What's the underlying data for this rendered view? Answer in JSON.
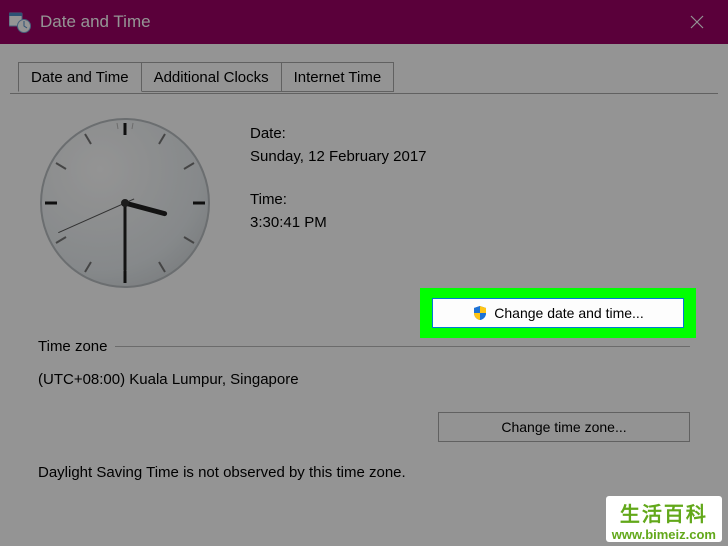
{
  "window": {
    "title": "Date and Time"
  },
  "tabs": {
    "date_and_time": "Date and Time",
    "additional_clocks": "Additional Clocks",
    "internet_time": "Internet Time"
  },
  "labels": {
    "date": "Date:",
    "time": "Time:",
    "time_zone": "Time zone"
  },
  "values": {
    "date": "Sunday, 12 February 2017",
    "time": "3:30:41 PM",
    "time_zone": "(UTC+08:00) Kuala Lumpur, Singapore"
  },
  "buttons": {
    "change_date_time": "Change date and time...",
    "change_time_zone": "Change time zone..."
  },
  "notes": {
    "dst": "Daylight Saving Time is not observed by this time zone."
  },
  "clock": {
    "hours": 3,
    "minutes": 30,
    "seconds": 41
  },
  "watermark": {
    "cn": "生活百科",
    "domain": "www.bimeiz.com"
  }
}
